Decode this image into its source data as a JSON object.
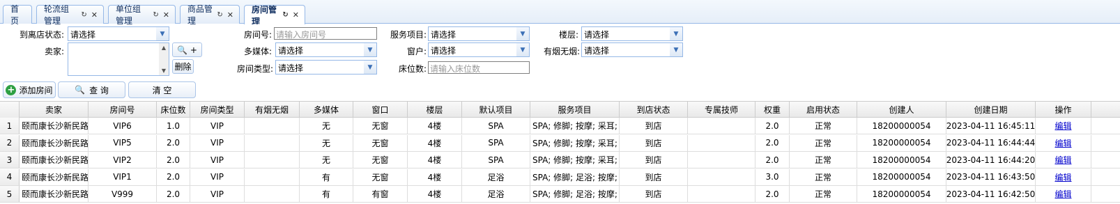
{
  "tabs": [
    {
      "label": "首页",
      "closable": false
    },
    {
      "label": "轮流组管理",
      "closable": true
    },
    {
      "label": "单位组管理",
      "closable": true
    },
    {
      "label": "商品管理",
      "closable": true
    },
    {
      "label": "房间管理",
      "closable": true,
      "active": true
    }
  ],
  "filters": {
    "arrive_status": {
      "label": "到离店状态:",
      "value": "请选择"
    },
    "seller": {
      "label": "卖家:"
    },
    "search_btn": "🔍 +",
    "delete_btn": "删除",
    "room_no": {
      "label": "房间号:",
      "placeholder": "请输入房间号"
    },
    "multimedia": {
      "label": "多媒体:",
      "value": "请选择"
    },
    "room_type": {
      "label": "房间类型:",
      "value": "请选择"
    },
    "service": {
      "label": "服务项目:",
      "value": "请选择"
    },
    "window": {
      "label": "窗户:",
      "value": "请选择"
    },
    "bed_count": {
      "label": "床位数:",
      "placeholder": "请输入床位数"
    },
    "floor": {
      "label": "楼层:",
      "value": "请选择"
    },
    "smoking": {
      "label": "有烟无烟:",
      "value": "请选择"
    }
  },
  "toolbar": {
    "add_label": "添加房间",
    "query_label": "查 询",
    "clear_label": "清 空"
  },
  "table": {
    "headers": [
      "卖家",
      "房间号",
      "床位数",
      "房间类型",
      "有烟无烟",
      "多媒体",
      "窗口",
      "楼层",
      "默认项目",
      "服务项目",
      "到店状态",
      "专属技师",
      "权重",
      "启用状态",
      "创建人",
      "创建日期",
      "操作"
    ],
    "rows": [
      {
        "n": "1",
        "cells": [
          "颐而康长沙新民路",
          "VIP6",
          "1.0",
          "VIP",
          "",
          "无",
          "无窗",
          "4楼",
          "SPA",
          "SPA; 修脚; 按摩; 采耳;",
          "到店",
          "",
          "2.0",
          "正常",
          "18200000054",
          "2023-04-11 16:45:11",
          "编辑"
        ]
      },
      {
        "n": "2",
        "cells": [
          "颐而康长沙新民路",
          "VIP5",
          "2.0",
          "VIP",
          "",
          "无",
          "无窗",
          "4楼",
          "SPA",
          "SPA; 修脚; 按摩; 采耳;",
          "到店",
          "",
          "2.0",
          "正常",
          "18200000054",
          "2023-04-11 16:44:44",
          "编辑"
        ]
      },
      {
        "n": "3",
        "cells": [
          "颐而康长沙新民路",
          "VIP2",
          "2.0",
          "VIP",
          "",
          "无",
          "无窗",
          "4楼",
          "SPA",
          "SPA; 修脚; 按摩; 采耳;",
          "到店",
          "",
          "2.0",
          "正常",
          "18200000054",
          "2023-04-11 16:44:20",
          "编辑"
        ]
      },
      {
        "n": "4",
        "cells": [
          "颐而康长沙新民路",
          "VIP1",
          "2.0",
          "VIP",
          "",
          "有",
          "无窗",
          "4楼",
          "足浴",
          "SPA; 修脚; 足浴; 按摩; 采",
          "到店",
          "",
          "3.0",
          "正常",
          "18200000054",
          "2023-04-11 16:43:50",
          "编辑"
        ]
      },
      {
        "n": "5",
        "cells": [
          "颐而康长沙新民路",
          "V999",
          "2.0",
          "VIP",
          "",
          "有",
          "有窗",
          "4楼",
          "足浴",
          "SPA; 修脚; 足浴; 按摩; 采",
          "到店",
          "",
          "2.0",
          "正常",
          "18200000054",
          "2023-04-11 16:42:50",
          "编辑"
        ]
      }
    ]
  }
}
